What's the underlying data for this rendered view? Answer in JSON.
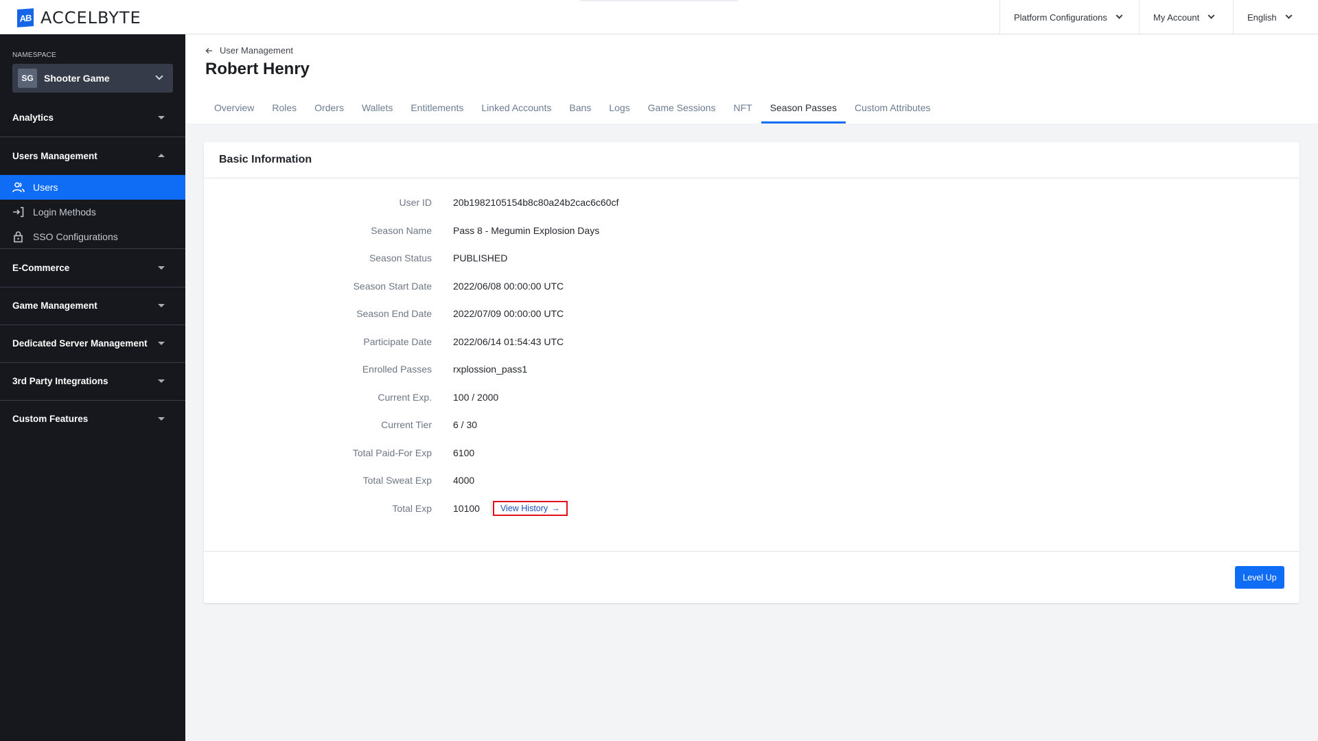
{
  "app": {
    "brand": "ACCELBYTE",
    "logo_mark": "AB"
  },
  "topbar": {
    "menus": [
      {
        "label": "Platform Configurations",
        "icon": "chevron-down-icon"
      },
      {
        "label": "My Account",
        "icon": "chevron-down-icon"
      },
      {
        "label": "English",
        "icon": "chevron-down-icon"
      }
    ]
  },
  "sidebar": {
    "namespace_label": "NAMESPACE",
    "namespace": {
      "badge": "SG",
      "name": "Shooter Game"
    },
    "groups": [
      {
        "label": "Analytics",
        "expanded": false
      },
      {
        "label": "Users Management",
        "expanded": true,
        "items": [
          {
            "label": "Users",
            "icon": "users-icon",
            "active": true
          },
          {
            "label": "Login Methods",
            "icon": "login-icon",
            "active": false
          },
          {
            "label": "SSO Configurations",
            "icon": "lock-icon",
            "active": false
          }
        ]
      },
      {
        "label": "E-Commerce",
        "expanded": false
      },
      {
        "label": "Game Management",
        "expanded": false
      },
      {
        "label": "Dedicated Server Management",
        "expanded": false
      },
      {
        "label": "3rd Party Integrations",
        "expanded": false
      },
      {
        "label": "Custom Features",
        "expanded": false
      }
    ]
  },
  "page": {
    "breadcrumb": "User Management",
    "title": "Robert Henry",
    "tabs": [
      {
        "label": "Overview"
      },
      {
        "label": "Roles"
      },
      {
        "label": "Orders"
      },
      {
        "label": "Wallets"
      },
      {
        "label": "Entitlements"
      },
      {
        "label": "Linked Accounts"
      },
      {
        "label": "Bans"
      },
      {
        "label": "Logs"
      },
      {
        "label": "Game Sessions"
      },
      {
        "label": "NFT"
      },
      {
        "label": "Season Passes",
        "active": true
      },
      {
        "label": "Custom Attributes"
      }
    ]
  },
  "card": {
    "title": "Basic Information",
    "rows": [
      {
        "label": "User ID",
        "value": "20b1982105154b8c80a24b2cac6c60cf"
      },
      {
        "label": "Season Name",
        "value": "Pass 8 - Megumin Explosion Days"
      },
      {
        "label": "Season Status",
        "value": "PUBLISHED"
      },
      {
        "label": "Season Start Date",
        "value": "2022/06/08 00:00:00 UTC"
      },
      {
        "label": "Season End Date",
        "value": "2022/07/09 00:00:00 UTC"
      },
      {
        "label": "Participate Date",
        "value": "2022/06/14 01:54:43 UTC"
      },
      {
        "label": "Enrolled Passes",
        "value": "rxplossion_pass1"
      },
      {
        "label": "Current Exp.",
        "value": "100 / 2000"
      },
      {
        "label": "Current Tier",
        "value": "6 / 30"
      },
      {
        "label": "Total Paid-For Exp",
        "value": "6100"
      },
      {
        "label": "Total Sweat Exp",
        "value": "4000"
      },
      {
        "label": "Total Exp",
        "value": "10100"
      }
    ],
    "view_history_label": "View History",
    "view_history_arrow": "→",
    "level_up_label": "Level Up"
  },
  "colors": {
    "accent": "#0f6cf5",
    "sidebar_bg": "#16181d",
    "highlight_border": "#e0111b"
  }
}
